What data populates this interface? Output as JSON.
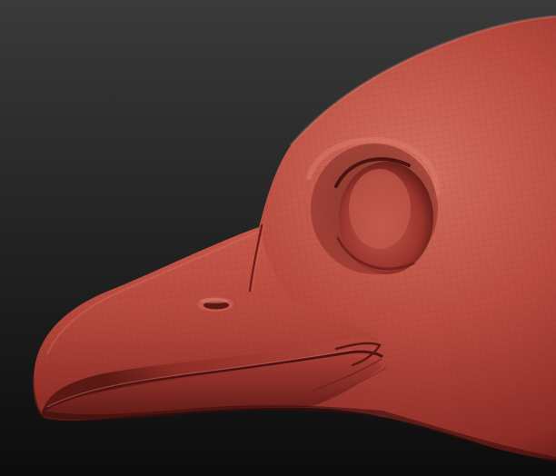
{
  "scene": {
    "subject": "sculpted-bird-head",
    "colors": {
      "background_top": "#3a3a3a",
      "background_bottom": "#0c0c0c",
      "clay_highlight": "#d06a60",
      "clay_base": "#b5473e",
      "clay_shadow": "#6e1f1a",
      "clay_deep": "#4a1210",
      "wire": "#8a2e28"
    }
  }
}
